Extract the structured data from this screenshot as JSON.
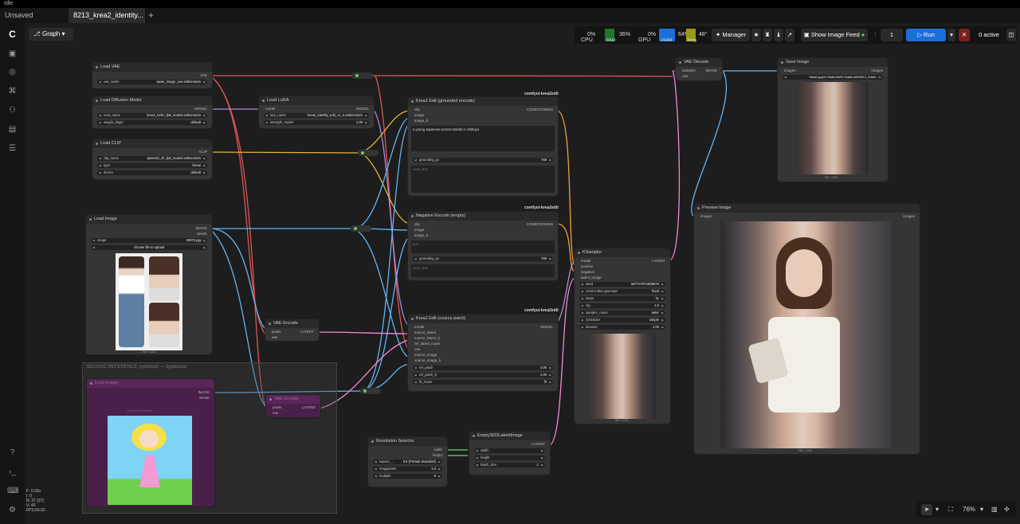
{
  "window": {
    "status": "Idle"
  },
  "tabs": [
    {
      "label": "Unsaved Workflow"
    },
    {
      "label": "8213_krea2_identity..."
    }
  ],
  "toolbar": {
    "graph_label": "Graph",
    "cpu_label": "CPU",
    "cpu_value": "0%",
    "ram_label": "RAM",
    "ram_value": "36%",
    "gpu_label": "GPU",
    "gpu_value": "0%",
    "vram_label": "VRAM",
    "vram_value": "64%",
    "temp_label": "Temp",
    "temp_value": "48°",
    "manager_label": "Manager",
    "image_feed_label": "Show Image Feed",
    "batch_count": "1",
    "run_label": "Run",
    "active_label": "0 active",
    "colors": {
      "ram": "#1a7a2a",
      "vram": "#1d6fd8",
      "temp": "#9a9a1a",
      "run": "#1d6fd8"
    }
  },
  "nodes": {
    "load_vae": {
      "title": "Load VAE",
      "out": "VAE",
      "w_label": "vae_name",
      "w_value": "qwen_image_vae.safetensors"
    },
    "load_diffusion": {
      "title": "Load Diffusion Model",
      "out": "MODEL",
      "w1_label": "unet_name",
      "w1_value": "krea2_turbo_fp8_scaled.safetensors",
      "w2_label": "weight_dtype",
      "w2_value": "default"
    },
    "load_clip": {
      "title": "Load CLIP",
      "out": "CLIP",
      "w1_label": "clip_name",
      "w1_value": "qwen3vl_4b_fp8_scaled.safetensors",
      "w2_label": "type",
      "w2_value": "krea2",
      "w3_label": "device",
      "w3_value": "default"
    },
    "load_lora": {
      "title": "Load LoRA",
      "in": "model",
      "out": "MODEL",
      "w1_label": "lora_name",
      "w1_value": "krea2_identity_edit_v1_0.safetensors",
      "w2_label": "strength_model",
      "w2_value": "1.00"
    },
    "load_image": {
      "title": "Load Image",
      "out1": "IMAGE",
      "out2": "MASK",
      "w_label": "image",
      "w_value": "33072.jpg",
      "upload_label": "choose file to upload",
      "size": "768 × 1024"
    },
    "vae_encode": {
      "title": "VAE Encode",
      "in1": "pixels",
      "in2": "vae",
      "out": "LATENT"
    },
    "krea_edit_prompt": {
      "title": "Krea2 Edit (grounded encode)",
      "badge": "comfyui-krea2edit",
      "in1": "clip",
      "in2": "image",
      "in3": "image_b",
      "out": "CONDITIONING",
      "text": "a young Japanese woman stands in Shibuya",
      "w_label": "grounding_px",
      "w_value": "768",
      "hint": "extra_text"
    },
    "krea_edit_neg": {
      "title": "Negative Encode (empty)",
      "badge": "comfyui-krea2edit",
      "in1": "clip",
      "in2": "image",
      "in3": "image_b",
      "out": "CONDITIONING",
      "hint1": "text",
      "w_label": "grounding_px",
      "w_value": "768",
      "hint2": "extra_text"
    },
    "krea_edit_source": {
      "title": "Krea2 Edit (source patch)",
      "badge": "comfyui-krea2edit",
      "in": [
        "model",
        "source_latent",
        "source_latent_b",
        "ref_latent_mask",
        "vae",
        "source_image",
        "source_image_b"
      ],
      "out": "MODEL",
      "w1_label": "ref_patch",
      "w1_value": "4.00",
      "w2_label": "ref_patch_b",
      "w2_value": "1.00",
      "w3_label": "fit_mode",
      "w3_value": "fit"
    },
    "ksampler": {
      "title": "KSampler",
      "in": [
        "model",
        "positive",
        "negative",
        "latent_image"
      ],
      "out": "LATENT",
      "w": [
        {
          "label": "seed",
          "value": "597747971608573"
        },
        {
          "label": "control after generate",
          "value": "fixed"
        },
        {
          "label": "steps",
          "value": "11"
        },
        {
          "label": "cfg",
          "value": "1.0"
        },
        {
          "label": "sampler_name",
          "value": "euler"
        },
        {
          "label": "scheduler",
          "value": "simple"
        },
        {
          "label": "denoise",
          "value": "1.00"
        }
      ],
      "size": "768 × 1024"
    },
    "vae_decode": {
      "title": "VAE Decode",
      "in1": "samples",
      "in2": "vae",
      "out": "IMAGE"
    },
    "save_image": {
      "title": "Save Image",
      "in": "images",
      "out": "images",
      "w_value": "%date:yyyy%-%date:MM%-%date:dd%/8213_%date...",
      "size": "768 × 1024"
    },
    "preview_image": {
      "title": "Preview Image",
      "in": "images",
      "out": "images",
      "size": "768 × 1024"
    },
    "resolution": {
      "title": "Resolution Selector",
      "out1": "width",
      "out2": "height",
      "w": [
        {
          "label": "aspect_...",
          "value": "3:4 (Portrait Standard)"
        },
        {
          "label": "megapixels",
          "value": "1.0"
        },
        {
          "label": "multiple",
          "value": "8"
        }
      ]
    },
    "empty_latent": {
      "title": "EmptySD3LatentImage",
      "out": "LATENT",
      "in1": "width",
      "in2": "height",
      "w_label": "batch_size",
      "w_value": "1"
    },
    "bypass_group": {
      "title": "SECOND REFERENCE (optional) — bypassed",
      "img_title": "Load Image",
      "out1": "IMAGE",
      "out2": "MASK",
      "enc_title": "VAE Encode",
      "enc_in1": "pixels",
      "enc_in2": "vae",
      "enc_out": "LATENT",
      "hint": "choose file to upload"
    }
  },
  "statusbar": {
    "lines": [
      "F: 0.00s",
      "I: 0",
      "N: 37 [37]",
      "V: 46",
      "FPS:59.52"
    ],
    "zoom": "76%"
  }
}
